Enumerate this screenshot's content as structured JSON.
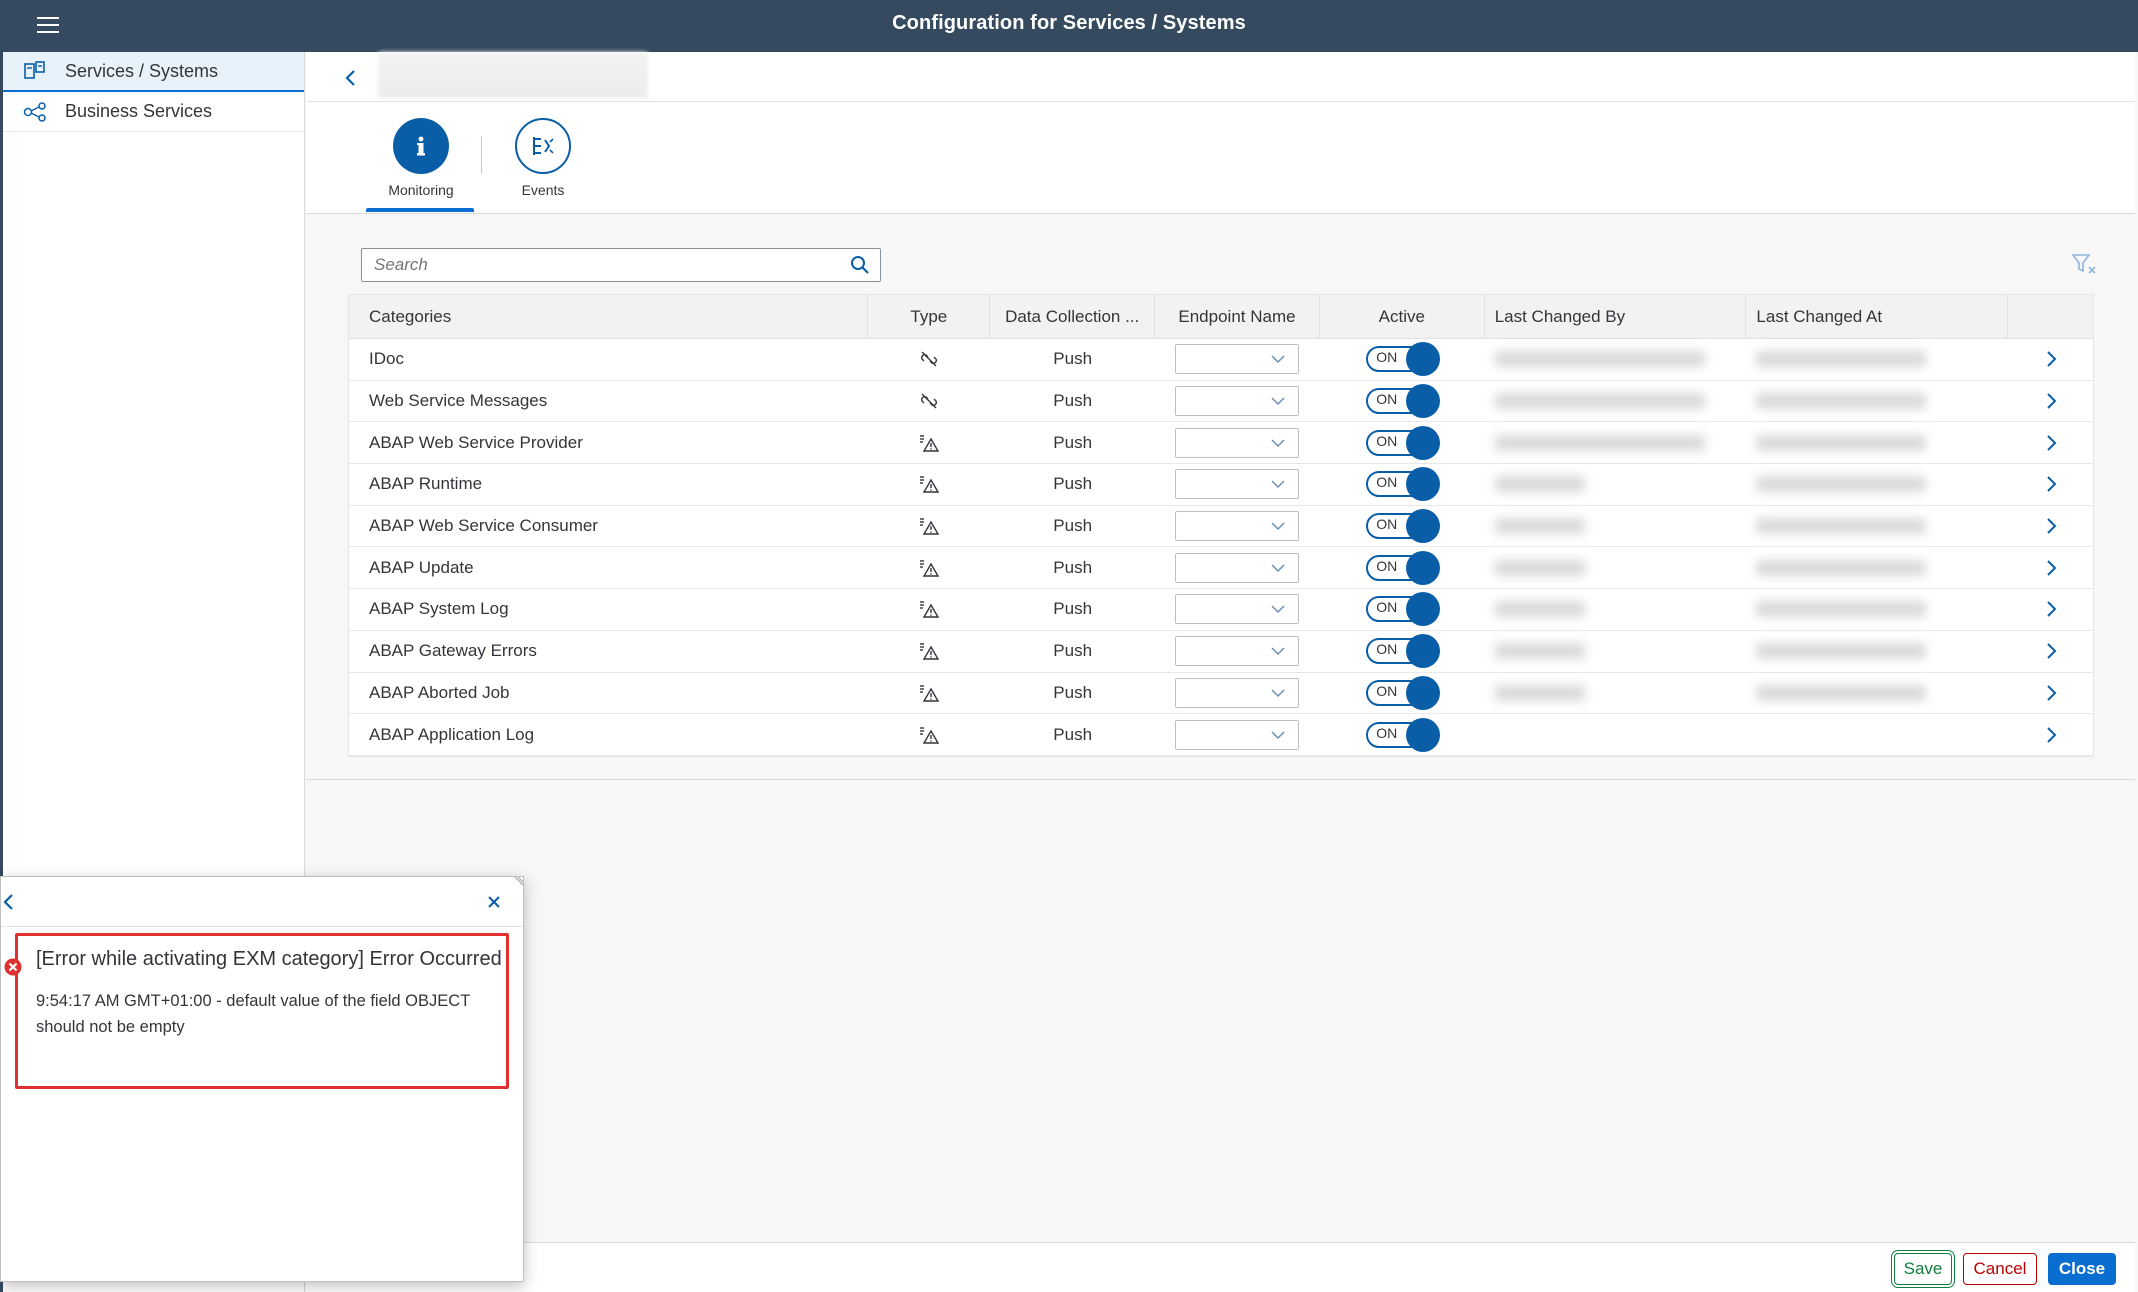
{
  "shell": {
    "title": "Configuration for Services / Systems"
  },
  "sidebar": {
    "items": [
      {
        "label": "Services / Systems",
        "icon": "systems-icon",
        "active": true
      },
      {
        "label": "Business Services",
        "icon": "network-icon",
        "active": false
      }
    ]
  },
  "tabs": [
    {
      "label": "Monitoring",
      "icon": "info-icon",
      "selected": true
    },
    {
      "label": "Events",
      "icon": "events-icon",
      "selected": false
    }
  ],
  "search": {
    "placeholder": "Search"
  },
  "table": {
    "columns": [
      "Categories",
      "Type",
      "Data Collection ...",
      "Endpoint Name",
      "Active",
      "Last Changed By",
      "Last Changed At"
    ],
    "rows": [
      {
        "category": "IDoc",
        "type_icon": "unlink-icon",
        "data_collection": "Push",
        "active": "ON"
      },
      {
        "category": "Web Service Messages",
        "type_icon": "unlink-icon",
        "data_collection": "Push",
        "active": "ON"
      },
      {
        "category": "ABAP Web Service Provider",
        "type_icon": "alert-list-icon",
        "data_collection": "Push",
        "active": "ON"
      },
      {
        "category": "ABAP Runtime",
        "type_icon": "alert-list-icon",
        "data_collection": "Push",
        "active": "ON"
      },
      {
        "category": "ABAP Web Service Consumer",
        "type_icon": "alert-list-icon",
        "data_collection": "Push",
        "active": "ON"
      },
      {
        "category": "ABAP Update",
        "type_icon": "alert-list-icon",
        "data_collection": "Push",
        "active": "ON"
      },
      {
        "category": "ABAP System Log",
        "type_icon": "alert-list-icon",
        "data_collection": "Push",
        "active": "ON"
      },
      {
        "category": "ABAP Gateway Errors",
        "type_icon": "alert-list-icon",
        "data_collection": "Push",
        "active": "ON"
      },
      {
        "category": "ABAP Aborted Job",
        "type_icon": "alert-list-icon",
        "data_collection": "Push",
        "active": "ON"
      },
      {
        "category": "ABAP Application Log",
        "type_icon": "alert-list-icon",
        "data_collection": "Push",
        "active": "ON"
      }
    ]
  },
  "footer": {
    "save": "Save",
    "cancel": "Cancel",
    "close": "Close"
  },
  "message": {
    "title": "[Error while activating EXM category] Error Occurred",
    "description": "9:54:17 AM GMT+01:00 - default value of the field OBJECT should not be empty"
  },
  "colors": {
    "shell": "#354a5f",
    "accent": "#0a5ea8",
    "error": "#bb0000",
    "positive": "#107e3e"
  }
}
